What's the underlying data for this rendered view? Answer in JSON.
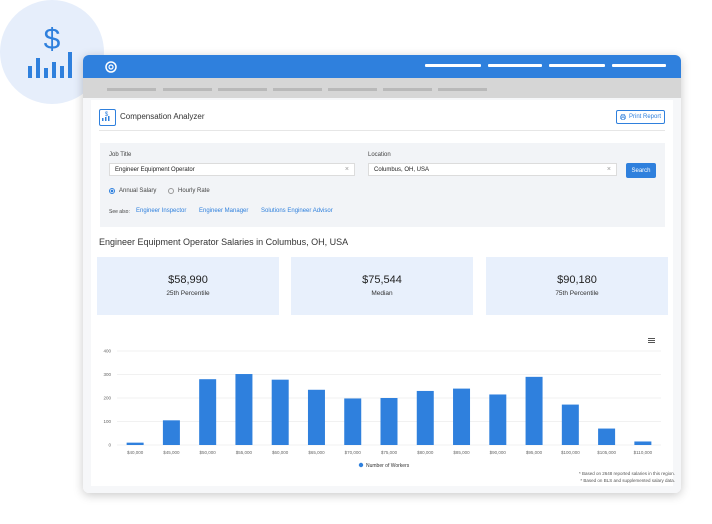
{
  "badge": {
    "icon": "dollar-chart-icon",
    "color": "#2f80dd"
  },
  "app": {
    "title": "Compensation Analyzer",
    "print_label": "Print Report"
  },
  "form": {
    "job_title_label": "Job Title",
    "job_title_value": "Engineer Equipment Operator",
    "location_label": "Location",
    "location_value": "Columbus, OH, USA",
    "search_label": "Search",
    "radio_annual": "Annual Salary",
    "radio_hourly": "Hourly Rate",
    "see_also_label": "See also:",
    "see_also": [
      "Engineer Inspector",
      "Engineer Manager",
      "Solutions Engineer Advisor"
    ]
  },
  "heading": "Engineer Equipment Operator Salaries in Columbus, OH, USA",
  "stats": [
    {
      "value": "$58,990",
      "label": "25th Percentile"
    },
    {
      "value": "$75,544",
      "label": "Median"
    },
    {
      "value": "$90,180",
      "label": "75th Percentile"
    }
  ],
  "chart_data": {
    "type": "bar",
    "categories": [
      "$40,000",
      "$45,000",
      "$50,000",
      "$55,000",
      "$60,000",
      "$65,000",
      "$70,000",
      "$75,000",
      "$80,000",
      "$85,000",
      "$90,000",
      "$95,000",
      "$100,000",
      "$105,000",
      "$110,000"
    ],
    "values": [
      10,
      105,
      280,
      302,
      278,
      235,
      198,
      200,
      230,
      240,
      215,
      290,
      172,
      70,
      15
    ],
    "yticks": [
      0,
      100,
      200,
      300,
      400
    ],
    "ylim": [
      0,
      400
    ],
    "legend": "Number of Workers",
    "color": "#2f80dd",
    "grid": true,
    "legend_position": "bottom"
  },
  "footnotes": [
    "* Based on 2648 reported salaries in this region.",
    "* Based on BLS and supplemented salary data."
  ],
  "colors": {
    "accent": "#2f80dd",
    "stat_bg": "#e8f0fc",
    "form_bg": "#f2f4f7"
  }
}
